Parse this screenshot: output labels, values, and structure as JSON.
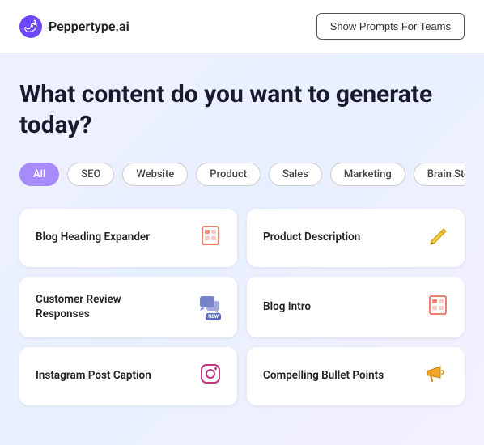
{
  "header": {
    "logo_text": "Peppertype.ai",
    "logo_symbol": "🌶",
    "teams_button_label": "Show Prompts For Teams"
  },
  "hero": {
    "headline": "What content do you want to generate today?"
  },
  "filters": {
    "items": [
      {
        "id": "all",
        "label": "All",
        "active": true
      },
      {
        "id": "seo",
        "label": "SEO",
        "active": false
      },
      {
        "id": "website",
        "label": "Website",
        "active": false
      },
      {
        "id": "product",
        "label": "Product",
        "active": false
      },
      {
        "id": "sales",
        "label": "Sales",
        "active": false
      },
      {
        "id": "marketing",
        "label": "Marketing",
        "active": false
      },
      {
        "id": "brain-storming",
        "label": "Brain Storming",
        "active": false
      }
    ]
  },
  "cards": [
    {
      "id": "blog-heading",
      "title": "Blog Heading Expander",
      "icon_name": "document-icon"
    },
    {
      "id": "product-desc",
      "title": "Product Description",
      "icon_name": "pencil-icon"
    },
    {
      "id": "customer-review",
      "title": "Customer Review Responses",
      "icon_name": "chat-icon"
    },
    {
      "id": "blog-intro",
      "title": "Blog Intro",
      "icon_name": "document-icon"
    },
    {
      "id": "instagram",
      "title": "Instagram Post Caption",
      "icon_name": "instagram-icon"
    },
    {
      "id": "bullet-points",
      "title": "Compelling Bullet Points",
      "icon_name": "megaphone-icon"
    }
  ],
  "colors": {
    "active_filter_bg": "#a78bfa",
    "primary_text": "#1a1a2e",
    "accent": "#6c47ff"
  }
}
